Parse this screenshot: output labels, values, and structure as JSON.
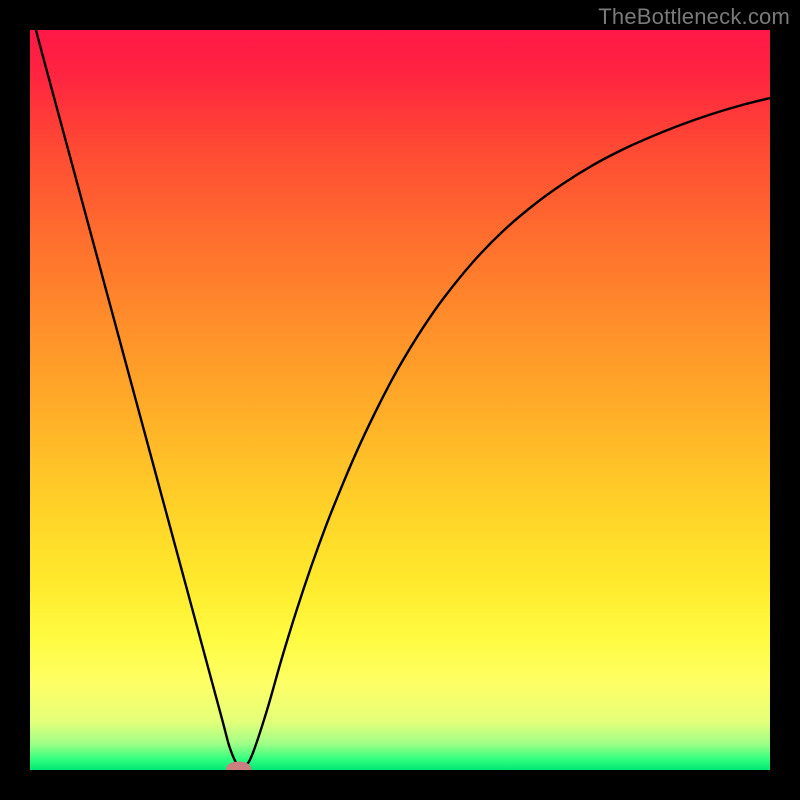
{
  "attribution": "TheBottleneck.com",
  "chart_data": {
    "type": "line",
    "title": "",
    "xlabel": "",
    "ylabel": "",
    "xlim": [
      0,
      100
    ],
    "ylim": [
      0,
      100
    ],
    "background_gradient": {
      "stops": [
        {
          "offset": 0.0,
          "color": "#ff1848"
        },
        {
          "offset": 0.06,
          "color": "#ff2440"
        },
        {
          "offset": 0.16,
          "color": "#ff4a34"
        },
        {
          "offset": 0.28,
          "color": "#ff6e2e"
        },
        {
          "offset": 0.4,
          "color": "#ff8f2a"
        },
        {
          "offset": 0.52,
          "color": "#ffaf28"
        },
        {
          "offset": 0.64,
          "color": "#ffd028"
        },
        {
          "offset": 0.74,
          "color": "#ffe82c"
        },
        {
          "offset": 0.82,
          "color": "#fffb40"
        },
        {
          "offset": 0.885,
          "color": "#fdff66"
        },
        {
          "offset": 0.935,
          "color": "#e4ff7a"
        },
        {
          "offset": 0.965,
          "color": "#9cff86"
        },
        {
          "offset": 0.985,
          "color": "#34ff80"
        },
        {
          "offset": 1.0,
          "color": "#00e874"
        }
      ]
    },
    "series": [
      {
        "name": "curve",
        "x": [
          0,
          2,
          4,
          6,
          8,
          10,
          12,
          14,
          16,
          18,
          20,
          22,
          24,
          26,
          27,
          28,
          29,
          30,
          32,
          34,
          36,
          38,
          40,
          42,
          44,
          46,
          48,
          50,
          53,
          56,
          60,
          64,
          68,
          72,
          76,
          80,
          84,
          88,
          92,
          96,
          100
        ],
        "y": [
          103,
          95.5,
          88.1,
          80.7,
          73.3,
          65.9,
          58.5,
          51.1,
          43.7,
          36.3,
          28.9,
          21.5,
          14.1,
          6.7,
          3.0,
          0.8,
          0.6,
          2.0,
          8.0,
          15.0,
          21.5,
          27.5,
          33.0,
          38.0,
          42.7,
          47.0,
          51.0,
          54.7,
          59.6,
          63.9,
          68.8,
          72.9,
          76.3,
          79.2,
          81.7,
          83.8,
          85.6,
          87.2,
          88.6,
          89.8,
          90.8
        ]
      }
    ],
    "marker": {
      "x": 28.2,
      "y": 0.2,
      "rx": 1.7,
      "ry": 0.95,
      "color": "#cc7f80"
    }
  }
}
